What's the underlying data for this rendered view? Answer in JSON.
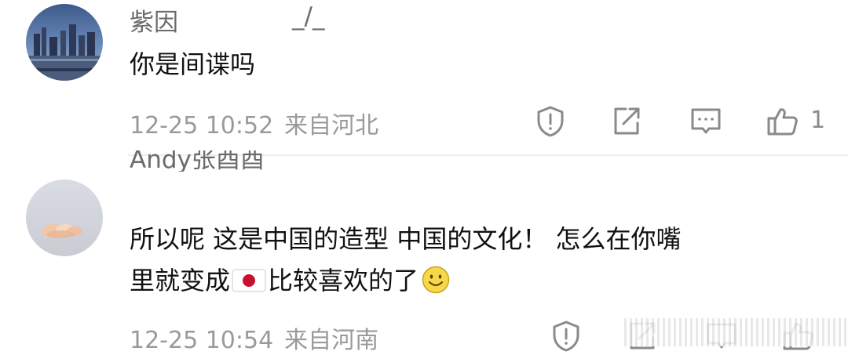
{
  "comments": [
    {
      "username": "紫因",
      "username_tail": "_/_",
      "text": "你是间谍吗",
      "timestamp": "12-25 10:52",
      "location": "来自河北",
      "likes": "1",
      "actions": [
        "report-icon",
        "share-icon",
        "reply-icon",
        "like-icon"
      ]
    },
    {
      "username": "Andy张酉酉",
      "text_line1": "所以呢 这是中国的造型 中国的文化！ 怎么在你嘴",
      "text_line2_a": "里就变成",
      "text_line2_b": "比较喜欢的了",
      "timestamp": "12-25 10:54",
      "location": "来自河南",
      "actions": [
        "report-icon",
        "share-icon",
        "reply-icon",
        "like-icon"
      ]
    }
  ],
  "colors": {
    "meta": "#9a9a9a",
    "username": "#6b6b6b",
    "divider": "#eeeeee",
    "icon": "#8a8a8a"
  }
}
